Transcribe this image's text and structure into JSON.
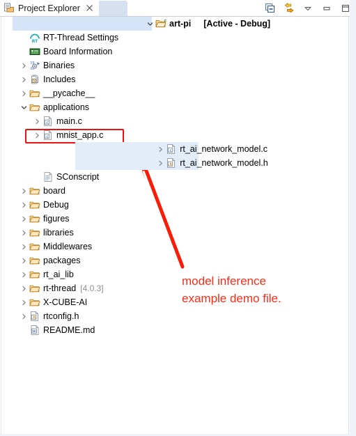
{
  "tab": {
    "title": "Project Explorer",
    "close_glyph": "⌧",
    "icon": "project-explorer-icon"
  },
  "toolbar": {
    "buttons": [
      {
        "name": "collapse-all-button",
        "tooltip": "Collapse All"
      },
      {
        "name": "link-with-editor-button",
        "tooltip": "Link with Editor"
      },
      {
        "name": "view-menu-button",
        "tooltip": "View Menu"
      },
      {
        "name": "minimize-button",
        "tooltip": "Minimize"
      },
      {
        "name": "maximize-button",
        "tooltip": "Maximize"
      }
    ]
  },
  "tree": {
    "root": {
      "label": "art-pi",
      "active_config": "[Active - Debug]",
      "expanded": true
    },
    "items": [
      {
        "label": "RT-Thread Settings",
        "icon": "rt-thread-settings-icon",
        "indent": 1,
        "twisty": "",
        "kind": "settings"
      },
      {
        "label": "Board Information",
        "icon": "board-information-icon",
        "indent": 1,
        "twisty": "",
        "kind": "board"
      },
      {
        "label": "Binaries",
        "icon": "binaries-icon",
        "indent": 1,
        "twisty": "collapsed",
        "kind": "binaries"
      },
      {
        "label": "Includes",
        "icon": "includes-icon",
        "indent": 1,
        "twisty": "collapsed",
        "kind": "includes"
      },
      {
        "label": "__pycache__",
        "icon": "folder-icon",
        "indent": 1,
        "twisty": "collapsed",
        "kind": "folder"
      },
      {
        "label": "applications",
        "icon": "folder-open-icon",
        "indent": 1,
        "twisty": "expanded",
        "kind": "folder"
      },
      {
        "label": "main.c",
        "icon": "c-file-icon",
        "indent": 2,
        "twisty": "collapsed",
        "kind": "c"
      },
      {
        "label": "mnist_app.c",
        "icon": "c-file-icon",
        "indent": 2,
        "twisty": "collapsed",
        "kind": "c",
        "boxed": true
      },
      {
        "label": "rt_ai_network_model.c",
        "icon": "c-file-icon",
        "indent": 2,
        "twisty": "collapsed",
        "kind": "c",
        "selected": true
      },
      {
        "label": "rt_ai_network_model.h",
        "icon": "h-file-icon",
        "indent": 2,
        "twisty": "collapsed",
        "kind": "h",
        "selected": true
      },
      {
        "label": "SConscript",
        "icon": "script-file-icon",
        "indent": 2,
        "twisty": "",
        "kind": "script"
      },
      {
        "label": "board",
        "icon": "folder-icon",
        "indent": 1,
        "twisty": "collapsed",
        "kind": "folder"
      },
      {
        "label": "Debug",
        "icon": "folder-icon",
        "indent": 1,
        "twisty": "collapsed",
        "kind": "folder"
      },
      {
        "label": "figures",
        "icon": "folder-icon",
        "indent": 1,
        "twisty": "collapsed",
        "kind": "folder"
      },
      {
        "label": "libraries",
        "icon": "folder-icon",
        "indent": 1,
        "twisty": "collapsed",
        "kind": "folder"
      },
      {
        "label": "Middlewares",
        "icon": "folder-icon",
        "indent": 1,
        "twisty": "collapsed",
        "kind": "folder"
      },
      {
        "label": "packages",
        "icon": "folder-icon",
        "indent": 1,
        "twisty": "collapsed",
        "kind": "folder"
      },
      {
        "label": "rt_ai_lib",
        "icon": "folder-icon",
        "indent": 1,
        "twisty": "collapsed",
        "kind": "folder"
      },
      {
        "label": "rt-thread",
        "meta": "[4.0.3]",
        "icon": "folder-icon",
        "indent": 1,
        "twisty": "collapsed",
        "kind": "folder"
      },
      {
        "label": "X-CUBE-AI",
        "icon": "folder-icon",
        "indent": 1,
        "twisty": "collapsed",
        "kind": "folder"
      },
      {
        "label": "rtconfig.h",
        "icon": "h-file-icon",
        "indent": 1,
        "twisty": "collapsed",
        "kind": "h"
      },
      {
        "label": "README.md",
        "icon": "markdown-file-icon",
        "indent": 1,
        "twisty": "",
        "kind": "md"
      }
    ]
  },
  "annotation": {
    "text_line1": "model inference",
    "text_line2": "example demo file.",
    "color": "#ff2b16",
    "highlight_color": "#ee1111",
    "target_label": "mnist_app.c"
  }
}
